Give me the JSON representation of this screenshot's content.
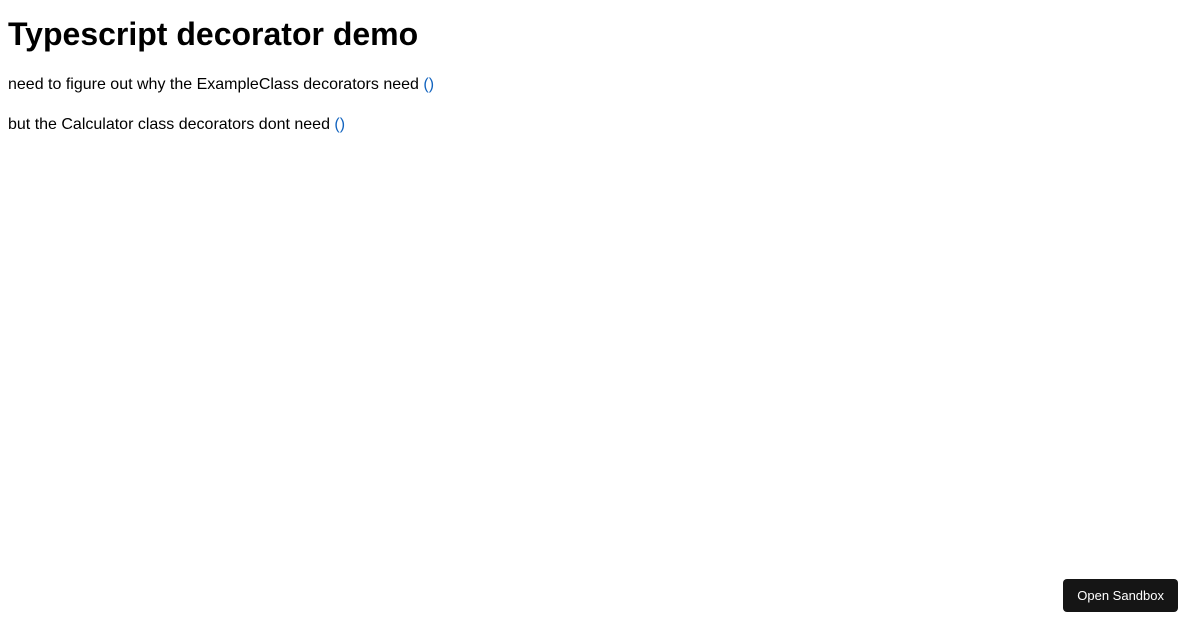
{
  "title": "Typescript decorator demo",
  "paragraphs": {
    "p1_text": "need to figure out why the ExampleClass decorators need ",
    "p1_trail": "()",
    "p2_text": "but the Calculator class decorators dont need ",
    "p2_trail": "()"
  },
  "button": {
    "open_sandbox_label": "Open Sandbox"
  }
}
